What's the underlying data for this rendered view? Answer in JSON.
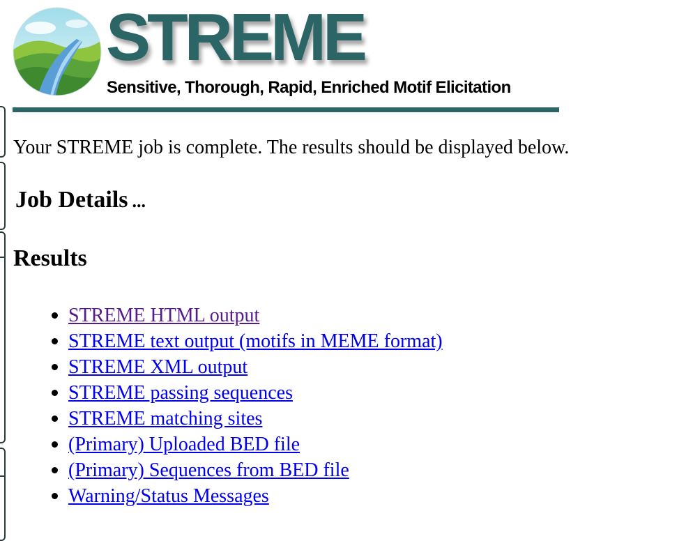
{
  "header": {
    "title": "STREME",
    "subtitle": "Sensitive, Thorough, Rapid, Enriched Motif Elicitation"
  },
  "intro_text": "Your STREME job is complete. The results should be displayed below.",
  "job_details": {
    "label": "Job Details",
    "toggle": "..."
  },
  "results": {
    "heading": "Results",
    "links": [
      {
        "label": "STREME HTML output",
        "visited": true
      },
      {
        "label": "STREME text output (motifs in MEME format)",
        "visited": false
      },
      {
        "label": "STREME XML output",
        "visited": false
      },
      {
        "label": "STREME passing sequences",
        "visited": false
      },
      {
        "label": "STREME matching sites",
        "visited": false
      },
      {
        "label": "(Primary) Uploaded BED file",
        "visited": false
      },
      {
        "label": "(Primary) Sequences from BED file",
        "visited": false
      },
      {
        "label": "Warning/Status Messages",
        "visited": false
      }
    ]
  },
  "colors": {
    "brand_teal": "#2b6566",
    "link": "#0000ee",
    "link_visited": "#551a8b"
  }
}
